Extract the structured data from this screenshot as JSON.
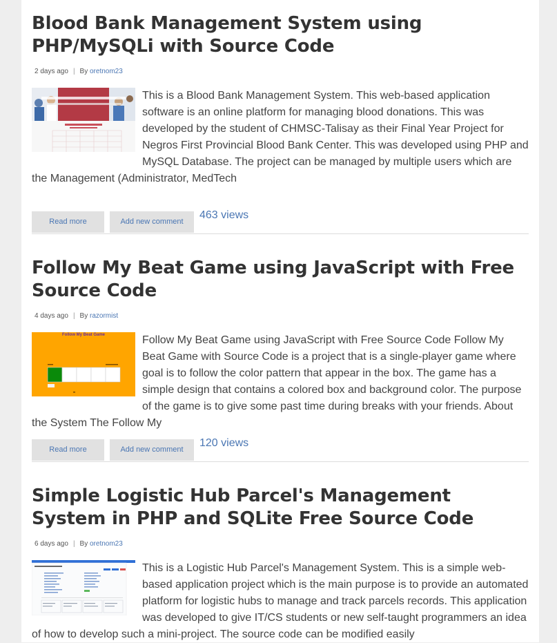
{
  "articles": [
    {
      "title": "Blood Bank Management System using PHP/MySQLi with Source Code",
      "date": "2 days ago",
      "by_label": "By",
      "author": "oretnom23",
      "summary": "This is a Blood Bank Management System. This web-based application software is an online platform for managing blood donations. This was developed by the student of CHMSC-Talisay as their Final Year Project for Negros First Provincial Blood Bank Center. This was developed using PHP and MySQL Database. The project can be managed by multiple users which are the Management (Administrator, MedTech",
      "read_more": "Read more",
      "add_comment": "Add new comment",
      "views": "463 views",
      "thumb_icon": "blood-bank-screenshot-thumbnail"
    },
    {
      "title": "Follow My Beat Game using JavaScript with Free Source Code",
      "date": "4 days ago",
      "by_label": "By",
      "author": "razormist",
      "summary": "Follow My Beat Game using JavaScript with Free Source Code Follow My Beat Game with Source Code is a project that is a single-player game where goal is to follow the color pattern that appear in the box. The game has a simple design that contains a colored box and background color. The purpose of the game is to give some past time during breaks with your friends. About the System The Follow My",
      "read_more": "Read more",
      "add_comment": "Add new comment",
      "views": "120 views",
      "thumb_title": "Follow My Beat Game",
      "thumb_icon": "beat-game-screenshot-thumbnail"
    },
    {
      "title": "Simple Logistic Hub Parcel's Management System in PHP and SQLite Free Source Code",
      "date": "6 days ago",
      "by_label": "By",
      "author": "oretnom23",
      "summary": "This is a Logistic Hub Parcel's Management System. This is a simple web-based application project which is the main purpose is to provide an automated platform for logistic hubs to manage and track parcels records. This application was developed to give IT/CS students or new self-taught programmers an idea of how to develop such a mini-project. The source code can be modified easily",
      "thumb_icon": "logistic-hub-screenshot-thumbnail"
    }
  ],
  "colors": {
    "link": "#4a76b3",
    "title": "#333333",
    "button_bg": "#e1e1e1",
    "beat_bg": "#ffa500"
  }
}
